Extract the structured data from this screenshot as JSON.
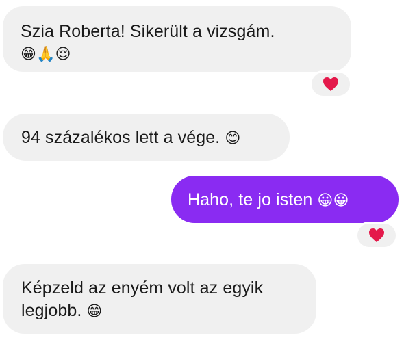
{
  "messages": [
    {
      "direction": "incoming",
      "lines": [
        "Szia Roberta! Sikerült a vizsgám.",
        "😁🙏😌"
      ],
      "reaction": "heart"
    },
    {
      "direction": "incoming",
      "text": "94 százalékos lett a vége.",
      "emoji": "😊"
    },
    {
      "direction": "outgoing",
      "text": "Haho, te jo isten",
      "emoji": "😀😀",
      "reaction": "heart"
    },
    {
      "direction": "incoming",
      "lines": [
        "Képzeld az enyém volt az egyik",
        "legjobb."
      ],
      "emoji": "😁"
    }
  ],
  "colors": {
    "incoming_bubble": "#f0f0f0",
    "outgoing_bubble": "#8a2bf2",
    "reaction_heart": "#e4194b"
  }
}
